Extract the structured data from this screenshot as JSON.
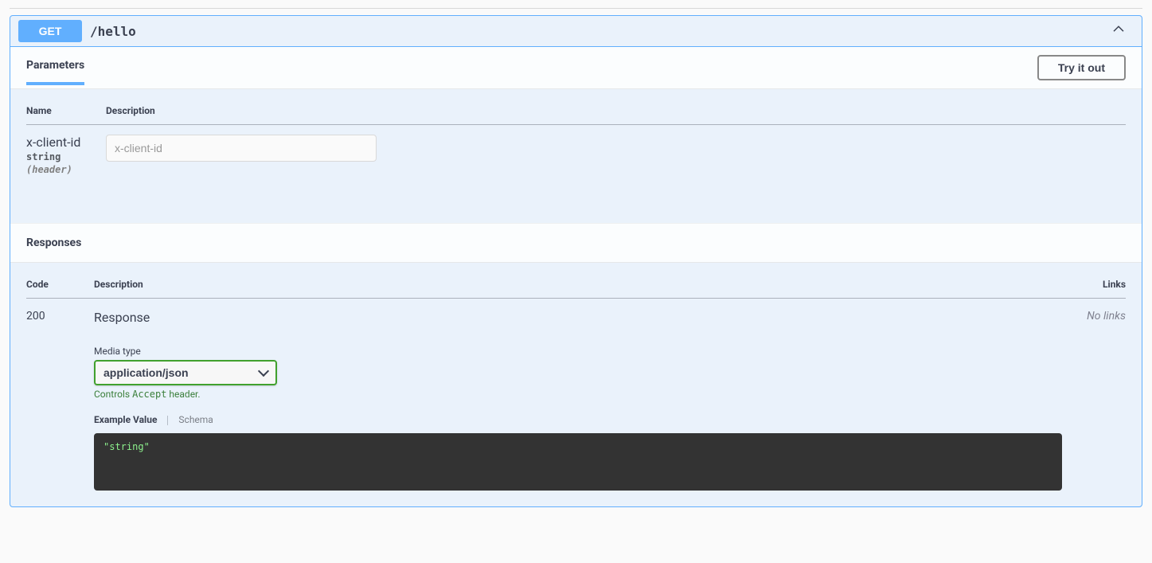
{
  "op": {
    "method": "GET",
    "path": "/hello"
  },
  "sections": {
    "parameters_label": "Parameters",
    "tryout_label": "Try it out",
    "responses_label": "Responses"
  },
  "param_headers": {
    "name": "Name",
    "description": "Description"
  },
  "param": {
    "name": "x-client-id",
    "type": "string",
    "in": "(header)",
    "placeholder": "x-client-id"
  },
  "resp_headers": {
    "code": "Code",
    "description": "Description",
    "links": "Links"
  },
  "response": {
    "code": "200",
    "description": "Response",
    "no_links": "No links",
    "media_label": "Media type",
    "media_value": "application/json",
    "controls_prefix": "Controls ",
    "controls_code": "Accept",
    "controls_suffix": " header.",
    "tab_example": "Example Value",
    "tab_schema": "Schema",
    "example_value": "\"string\""
  }
}
